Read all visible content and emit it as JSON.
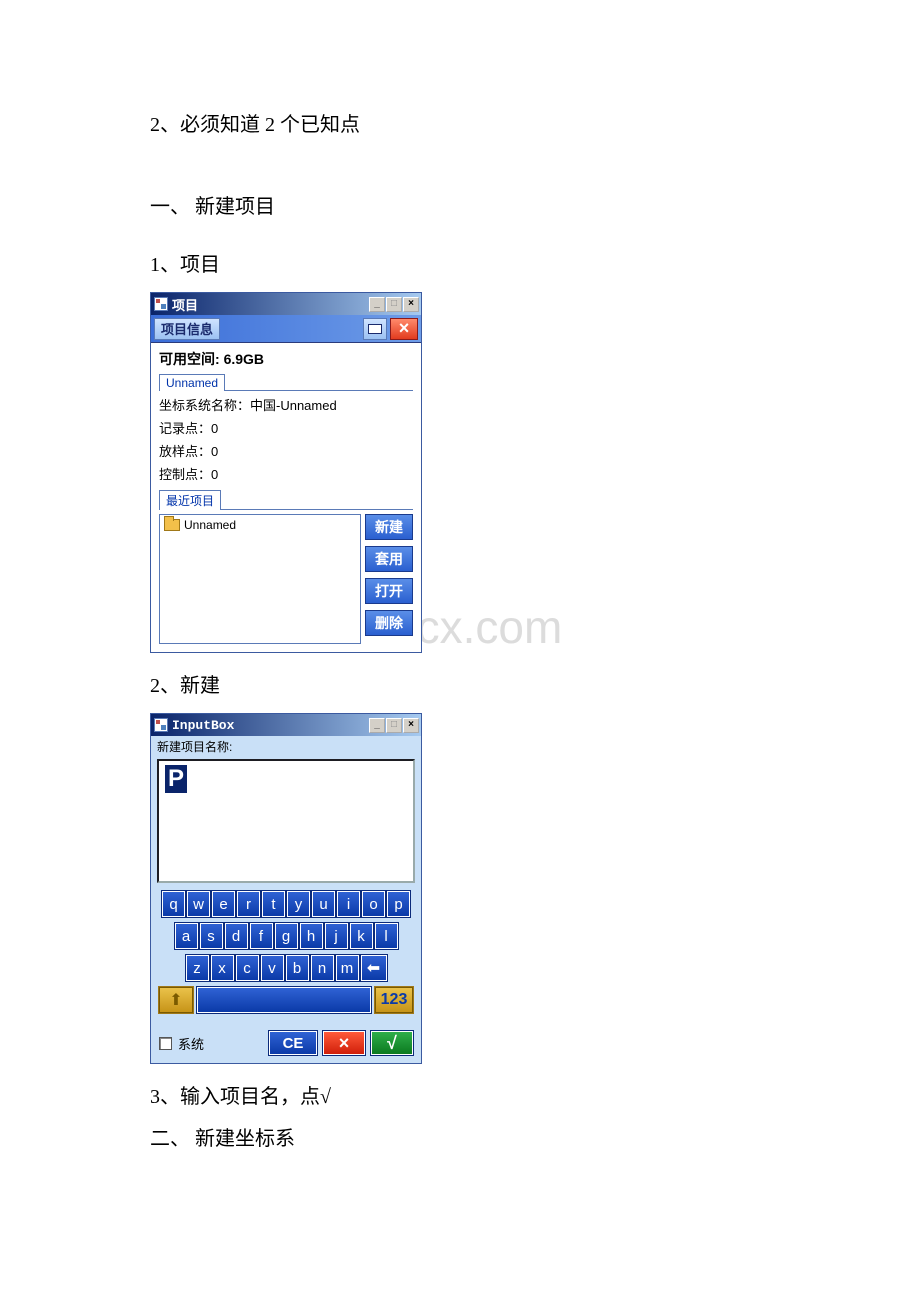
{
  "doc": {
    "prereq": "2、必须知道 2 个已知点",
    "h1": "一、 新建项目",
    "s1": "1、项目",
    "s2": "2、新建",
    "s3": "3、输入项目名，点√",
    "h2": "二、 新建坐标系"
  },
  "watermark": "www.bdocx.com",
  "win1": {
    "title": "项目",
    "min": "_",
    "max": "□",
    "close": "×",
    "toolbar_info": "项目信息",
    "toolbar_close": "×",
    "disk_label": "可用空间:",
    "disk_value": "6.9GB",
    "tab_unnamed": "Unnamed",
    "coord": "坐标系统名称：中国-Unnamed",
    "rec_pts": "记录点：0",
    "stake_pts": "放样点：0",
    "ctrl_pts": "控制点：0",
    "recent_label": "最近项目",
    "recent_item": "Unnamed",
    "btn_new": "新建",
    "btn_apply": "套用",
    "btn_open": "打开",
    "btn_del": "删除"
  },
  "win2": {
    "title": "InputBox",
    "min": "_",
    "max": "□",
    "close": "×",
    "prompt": "新建项目名称:",
    "value": "P",
    "row1": [
      "q",
      "w",
      "e",
      "r",
      "t",
      "y",
      "u",
      "i",
      "o",
      "p"
    ],
    "row2": [
      "a",
      "s",
      "d",
      "f",
      "g",
      "h",
      "j",
      "k",
      "l"
    ],
    "row3": [
      "z",
      "x",
      "c",
      "v",
      "b",
      "n",
      "m"
    ],
    "bksp": "⬅",
    "shift": "⬆",
    "num": "123",
    "sys": "系统",
    "ce": "CE",
    "cancel": "×",
    "ok": "√"
  }
}
